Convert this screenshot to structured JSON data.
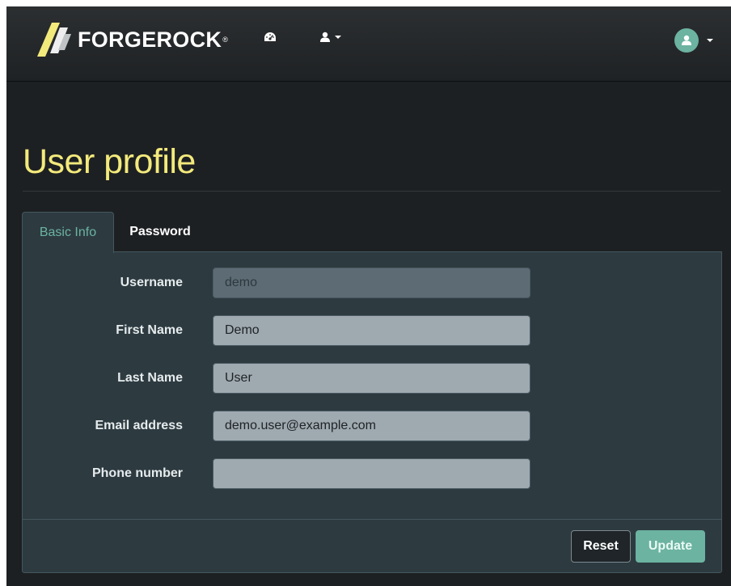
{
  "navbar": {
    "brand": "FORGEROCK",
    "brand_tm": "®",
    "icons": {
      "dashboard": "dashboard-icon",
      "user_menu": "user-icon",
      "avatar": "avatar-icon"
    }
  },
  "page": {
    "title": "User profile"
  },
  "tabs": [
    {
      "label": "Basic Info",
      "active": true
    },
    {
      "label": "Password",
      "active": false
    }
  ],
  "form": {
    "fields": [
      {
        "label": "Username",
        "value": "demo",
        "readonly": true
      },
      {
        "label": "First Name",
        "value": "Demo",
        "readonly": false
      },
      {
        "label": "Last Name",
        "value": "User",
        "readonly": false
      },
      {
        "label": "Email address",
        "value": "demo.user@example.com",
        "readonly": false
      },
      {
        "label": "Phone number",
        "value": "",
        "readonly": false
      }
    ]
  },
  "buttons": {
    "reset": "Reset",
    "update": "Update"
  },
  "colors": {
    "accent": "#6cb3a1",
    "title": "#f3ea7c",
    "background": "#1d2022",
    "panel": "#2d3b41"
  }
}
